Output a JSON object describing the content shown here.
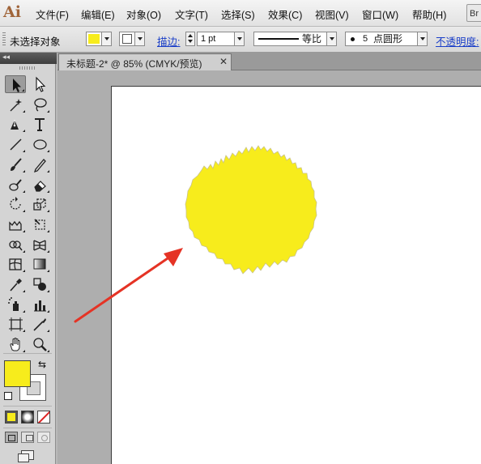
{
  "app": {
    "logo": "Ai"
  },
  "menu": [
    "文件(F)",
    "编辑(E)",
    "对象(O)",
    "文字(T)",
    "选择(S)",
    "效果(C)",
    "视图(V)",
    "窗口(W)",
    "帮助(H)"
  ],
  "menu_right_button": "Br",
  "controlbar": {
    "selection_label": "未选择对象",
    "fill_color": "#f7ec1c",
    "stroke_label": "描边:",
    "stroke_weight": "1 pt",
    "stroke_profile": "等比",
    "brush_size": "5",
    "brush_label": "点圆形",
    "opacity_label": "不透明度:"
  },
  "document": {
    "tab_title": "未标题-2* @ 85% (CMYK/预览)",
    "tab_close": "✕"
  },
  "toolbox": {
    "fill_color": "#f7ec1c",
    "stroke_color": "#ffffff",
    "tools": [
      "selection-tool-icon",
      "direct-selection-tool-icon",
      "magic-wand-tool-icon",
      "lasso-tool-icon",
      "pen-tool-icon",
      "type-tool-icon",
      "line-segment-tool-icon",
      "ellipse-tool-icon",
      "paintbrush-tool-icon",
      "pencil-tool-icon",
      "blob-brush-tool-icon",
      "eraser-tool-icon",
      "rotate-tool-icon",
      "scale-tool-icon",
      "warp-tool-icon",
      "free-transform-tool-icon",
      "shape-builder-tool-icon",
      "perspective-grid-tool-icon",
      "mesh-tool-icon",
      "gradient-tool-icon",
      "eyedropper-tool-icon",
      "blend-tool-icon",
      "symbol-sprayer-tool-icon",
      "column-graph-tool-icon",
      "artboard-tool-icon",
      "slice-tool-icon",
      "hand-tool-icon",
      "zoom-tool-icon"
    ]
  },
  "artwork": {
    "shape_fill": "#f7ec1c",
    "arrow_color": "#e53325"
  }
}
